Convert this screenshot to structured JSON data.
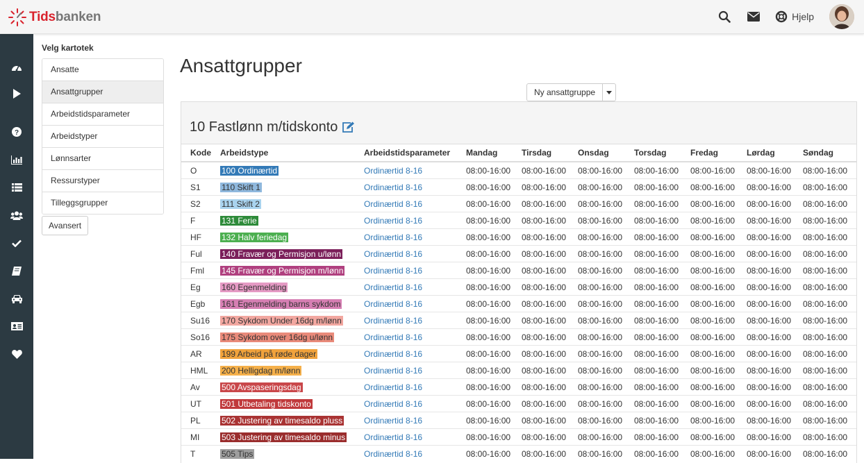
{
  "app": {
    "logo_part1": "Tids",
    "logo_part2": "banken"
  },
  "topbar": {
    "help_label": "Hjelp"
  },
  "leftnav": {
    "heading": "Velg kartotek",
    "items": [
      "Ansatte",
      "Ansattgrupper",
      "Arbeidstidsparameter",
      "Arbeidstyper",
      "Lønnsarter",
      "Ressurstyper",
      "Tilleggsgrupper"
    ],
    "advanced_label": "Avansert"
  },
  "page": {
    "title": "Ansattgrupper",
    "new_button": "Ny ansattgruppe"
  },
  "panel": {
    "title": "10 Fastlønn m/tidskonto"
  },
  "table": {
    "headers": [
      "Kode",
      "Arbeidstype",
      "Arbeidstidsparameter",
      "Mandag",
      "Tirsdag",
      "Onsdag",
      "Torsdag",
      "Fredag",
      "Lørdag",
      "Søndag"
    ],
    "rows": [
      {
        "kode": "O",
        "arbeidstype": "100 Ordinærtid",
        "color": "#337ab7",
        "dark": false,
        "param": "Ordinærtid 8-16",
        "days": [
          "08:00-16:00",
          "08:00-16:00",
          "08:00-16:00",
          "08:00-16:00",
          "08:00-16:00",
          "08:00-16:00",
          "08:00-16:00"
        ]
      },
      {
        "kode": "S1",
        "arbeidstype": "110 Skift 1",
        "color": "#8fb8dd",
        "dark": true,
        "param": "Ordinærtid 8-16",
        "days": [
          "08:00-16:00",
          "08:00-16:00",
          "08:00-16:00",
          "08:00-16:00",
          "08:00-16:00",
          "08:00-16:00",
          "08:00-16:00"
        ]
      },
      {
        "kode": "S2",
        "arbeidstype": "111 Skift 2",
        "color": "#a9d3ee",
        "dark": true,
        "param": "Ordinærtid 8-16",
        "days": [
          "08:00-16:00",
          "08:00-16:00",
          "08:00-16:00",
          "08:00-16:00",
          "08:00-16:00",
          "08:00-16:00",
          "08:00-16:00"
        ]
      },
      {
        "kode": "F",
        "arbeidstype": "131 Ferie",
        "color": "#2e8b3a",
        "dark": false,
        "param": "Ordinærtid 8-16",
        "days": [
          "08:00-16:00",
          "08:00-16:00",
          "08:00-16:00",
          "08:00-16:00",
          "08:00-16:00",
          "08:00-16:00",
          "08:00-16:00"
        ]
      },
      {
        "kode": "HF",
        "arbeidstype": "132 Halv feriedag",
        "color": "#4caf50",
        "dark": false,
        "param": "Ordinærtid 8-16",
        "days": [
          "08:00-16:00",
          "08:00-16:00",
          "08:00-16:00",
          "08:00-16:00",
          "08:00-16:00",
          "08:00-16:00",
          "08:00-16:00"
        ]
      },
      {
        "kode": "Ful",
        "arbeidstype": "140 Fravær og Permisjon u/lønn",
        "color": "#7b1f5a",
        "dark": false,
        "param": "Ordinærtid 8-16",
        "days": [
          "08:00-16:00",
          "08:00-16:00",
          "08:00-16:00",
          "08:00-16:00",
          "08:00-16:00",
          "08:00-16:00",
          "08:00-16:00"
        ]
      },
      {
        "kode": "Fml",
        "arbeidstype": "145 Fravær og Permisjon m/lønn",
        "color": "#b0407f",
        "dark": false,
        "param": "Ordinærtid 8-16",
        "days": [
          "08:00-16:00",
          "08:00-16:00",
          "08:00-16:00",
          "08:00-16:00",
          "08:00-16:00",
          "08:00-16:00",
          "08:00-16:00"
        ]
      },
      {
        "kode": "Eg",
        "arbeidstype": "160 Egenmelding",
        "color": "#e59ac4",
        "dark": true,
        "param": "Ordinærtid 8-16",
        "days": [
          "08:00-16:00",
          "08:00-16:00",
          "08:00-16:00",
          "08:00-16:00",
          "08:00-16:00",
          "08:00-16:00",
          "08:00-16:00"
        ]
      },
      {
        "kode": "Egb",
        "arbeidstype": "161 Egenmelding barns sykdom",
        "color": "#d67fb3",
        "dark": true,
        "param": "Ordinærtid 8-16",
        "days": [
          "08:00-16:00",
          "08:00-16:00",
          "08:00-16:00",
          "08:00-16:00",
          "08:00-16:00",
          "08:00-16:00",
          "08:00-16:00"
        ]
      },
      {
        "kode": "Su16",
        "arbeidstype": "170 Sykdom Under 16dg m/lønn",
        "color": "#f2a7a0",
        "dark": true,
        "param": "Ordinærtid 8-16",
        "days": [
          "08:00-16:00",
          "08:00-16:00",
          "08:00-16:00",
          "08:00-16:00",
          "08:00-16:00",
          "08:00-16:00",
          "08:00-16:00"
        ]
      },
      {
        "kode": "So16",
        "arbeidstype": "175 Sykdom over 16dg u/lønn",
        "color": "#e98a7a",
        "dark": true,
        "param": "Ordinærtid 8-16",
        "days": [
          "08:00-16:00",
          "08:00-16:00",
          "08:00-16:00",
          "08:00-16:00",
          "08:00-16:00",
          "08:00-16:00",
          "08:00-16:00"
        ]
      },
      {
        "kode": "AR",
        "arbeidstype": "199 Arbeid på røde dager",
        "color": "#f0a23c",
        "dark": true,
        "param": "Ordinærtid 8-16",
        "days": [
          "08:00-16:00",
          "08:00-16:00",
          "08:00-16:00",
          "08:00-16:00",
          "08:00-16:00",
          "08:00-16:00",
          "08:00-16:00"
        ]
      },
      {
        "kode": "HML",
        "arbeidstype": "200 Helligdag m/lønn",
        "color": "#f5b04a",
        "dark": true,
        "param": "Ordinærtid 8-16",
        "days": [
          "08:00-16:00",
          "08:00-16:00",
          "08:00-16:00",
          "08:00-16:00",
          "08:00-16:00",
          "08:00-16:00",
          "08:00-16:00"
        ]
      },
      {
        "kode": "Av",
        "arbeidstype": "500 Avspaseringsdag",
        "color": "#c9474a",
        "dark": false,
        "param": "Ordinærtid 8-16",
        "days": [
          "08:00-16:00",
          "08:00-16:00",
          "08:00-16:00",
          "08:00-16:00",
          "08:00-16:00",
          "08:00-16:00",
          "08:00-16:00"
        ]
      },
      {
        "kode": "UT",
        "arbeidstype": "501 Utbetaling tidskonto",
        "color": "#c0393b",
        "dark": false,
        "param": "Ordinærtid 8-16",
        "days": [
          "08:00-16:00",
          "08:00-16:00",
          "08:00-16:00",
          "08:00-16:00",
          "08:00-16:00",
          "08:00-16:00",
          "08:00-16:00"
        ]
      },
      {
        "kode": "PL",
        "arbeidstype": "502 Justering av timesaldo pluss",
        "color": "#a93333",
        "dark": false,
        "param": "Ordinærtid 8-16",
        "days": [
          "08:00-16:00",
          "08:00-16:00",
          "08:00-16:00",
          "08:00-16:00",
          "08:00-16:00",
          "08:00-16:00",
          "08:00-16:00"
        ]
      },
      {
        "kode": "MI",
        "arbeidstype": "503 Justering av timesaldo minus",
        "color": "#9a2d2d",
        "dark": false,
        "param": "Ordinærtid 8-16",
        "days": [
          "08:00-16:00",
          "08:00-16:00",
          "08:00-16:00",
          "08:00-16:00",
          "08:00-16:00",
          "08:00-16:00",
          "08:00-16:00"
        ]
      },
      {
        "kode": "T",
        "arbeidstype": "505 Tips",
        "color": "#9e9e9e",
        "dark": true,
        "param": "Ordinærtid 8-16",
        "days": [
          "08:00-16:00",
          "08:00-16:00",
          "08:00-16:00",
          "08:00-16:00",
          "08:00-16:00",
          "08:00-16:00",
          "08:00-16:00"
        ]
      }
    ]
  },
  "icons": {
    "logo": "tidsbanken-clock-logo",
    "search": "search-icon",
    "mail": "envelope-icon",
    "help": "lifebuoy-icon",
    "sidebar": [
      "dashboard-icon",
      "play-icon",
      "question-icon",
      "bar-chart-icon",
      "list-icon",
      "users-icon",
      "check-icon",
      "book-icon",
      "car-icon",
      "id-card-icon",
      "heart-icon"
    ],
    "edit": "edit-icon",
    "caret": "caret-down-icon"
  },
  "colors": {
    "sidebar": "#2c3a42",
    "brand_red": "#d9232d",
    "link": "#337ab7"
  }
}
